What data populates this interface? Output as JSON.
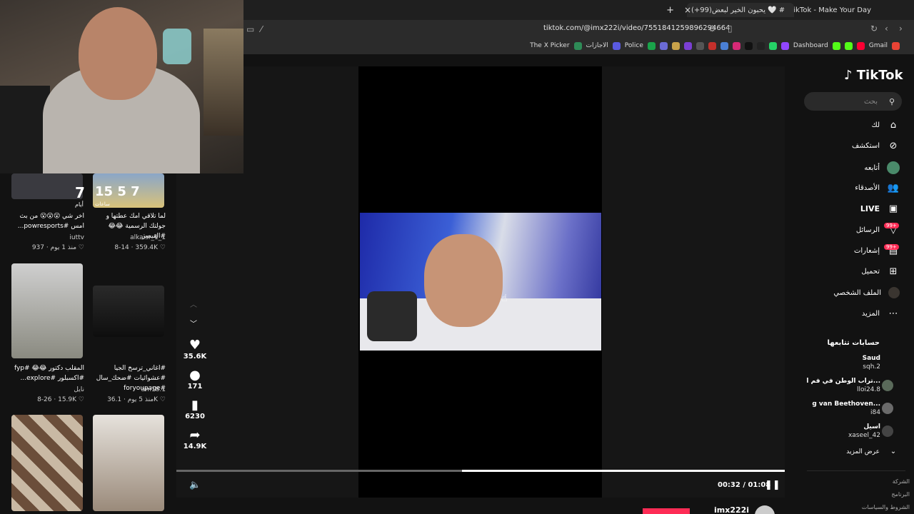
{
  "browser": {
    "tabs": [
      {
        "label": "(+99)TikTok - Make Your Day",
        "active": false
      },
      {
        "label": "(+99)يحبون الخير لبعض 🤍 #",
        "active": true
      }
    ],
    "new_tab": "+",
    "close_tab": "×",
    "url": "tiktok.com/@imx222i/video/7551841259896294664",
    "bookmarks": [
      "The X Picker",
      "الاجازات",
      "Police",
      "Dashboard",
      "Gmail"
    ]
  },
  "feed": {
    "items": [
      {
        "count": "7",
        "count_label": "أيام",
        "caption": "اخر شي 😮😮😮 من بث امس #powresports...",
        "author": "iuttv",
        "likes": "937",
        "date": "منذ 1 يوم"
      },
      {
        "count": "15 5 7",
        "count_label": "ساعات",
        "caption": "لما تلاقي امك عطتها و جولتك الرسمية 😂😂 #القيصر",
        "author": "alkaisr_1_1",
        "likes": "359.4K",
        "date": "8-14"
      },
      {
        "caption": "المقلب دكتور 😂😂 #fyp #اكسبلور #explore...",
        "author": "نايل",
        "likes": "15.9K",
        "date": "8-26"
      },
      {
        "caption": "#اغاني_ترسخ الجيا #عشوائيات #ضحك_سال #foryoupage",
        "author": "am18.1",
        "likes": "36.1K",
        "date": "منذ 5 يوم"
      }
    ]
  },
  "player": {
    "likes": "35.6K",
    "comments": "171",
    "saves": "6230",
    "shares": "14.9K",
    "time": "00:32 / 01:08",
    "progress": 0.47,
    "author": "imx222i"
  },
  "sidebar": {
    "logo": "TikTok",
    "search_placeholder": "بحث",
    "nav": [
      "لك",
      "استكشف",
      "أتابعه",
      "الأصدقاء",
      "LIVE",
      "الرسائل",
      "إشعارات",
      "تحميل",
      "الملف الشخصي",
      "المزيد"
    ],
    "badges": {
      "messages": "99+",
      "notifications": "99+"
    },
    "following_title": "حسابات تتابعها",
    "following": [
      {
        "name": "Saud",
        "handle": "sqh.2"
      },
      {
        "name": "تراب الوطن في فم ا...",
        "handle": "lloi24.8"
      },
      {
        "name": "g van Beethoven...",
        "handle": "i84"
      },
      {
        "name": "اسيل",
        "handle": "xaseel_42"
      }
    ],
    "show_more": "عرض المزيد",
    "footer": [
      "الشركة",
      "البرنامج",
      "الشروط والسياسات"
    ]
  }
}
